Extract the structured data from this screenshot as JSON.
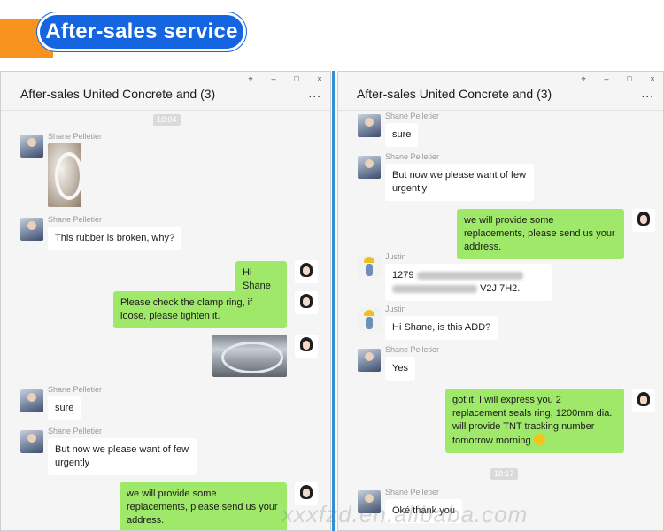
{
  "banner": {
    "title": "After-sales service",
    "strip_color": "#f7931e",
    "pill_color": "#1565e0"
  },
  "window_controls": {
    "pin": "⌖",
    "minimize": "–",
    "maximize": "□",
    "close": "×"
  },
  "more_icon": "...",
  "left": {
    "title": "After-sales United Concrete and  (3)",
    "timestamp": "18:04",
    "messages": [
      {
        "sender": "Shane Pelletier",
        "type": "image",
        "image": "clamp-ring-photo"
      },
      {
        "sender": "Shane Pelletier",
        "text": "This rubber is broken, why?"
      },
      {
        "sender": "me",
        "text": "Hi Shane"
      },
      {
        "sender": "me",
        "text": "Please check the clamp ring, if loose, please tighten it."
      },
      {
        "sender": "me",
        "type": "image",
        "image": "sieve-photo"
      },
      {
        "sender": "Shane Pelletier",
        "text": "sure"
      },
      {
        "sender": "Shane Pelletier",
        "text": "But now we please want of few urgently"
      },
      {
        "sender": "me",
        "text": "we will provide some replacements, please send us your address."
      }
    ]
  },
  "right": {
    "title": "After-sales United Concrete and  (3)",
    "timestamp": "18:17",
    "messages": [
      {
        "sender": "Shane Pelletier",
        "text": "sure"
      },
      {
        "sender": "Shane Pelletier",
        "text": "But now we please want of few urgently"
      },
      {
        "sender": "me",
        "text": "we will provide some replacements, please send us your address."
      },
      {
        "sender": "Justin",
        "line1": "1279",
        "line2_end": "V2J 7H2."
      },
      {
        "sender": "Justin",
        "text": "Hi Shane, is this ADD?"
      },
      {
        "sender": "Shane Pelletier",
        "text": "Yes"
      },
      {
        "sender": "me",
        "text": "got it, I will express you 2 replacement seals ring, 1200mm dia. will provide TNT tracking number tomorrow morning"
      },
      {
        "sender": "Shane Pelletier",
        "text": "Oké thank you"
      }
    ]
  },
  "watermark": "xxxfzd.en.alibaba.com",
  "colors": {
    "outgoing_bubble": "#9fe86a",
    "incoming_bubble": "#ffffff",
    "divider": "#2f8fd8",
    "chat_bg": "#f5f5f5"
  }
}
